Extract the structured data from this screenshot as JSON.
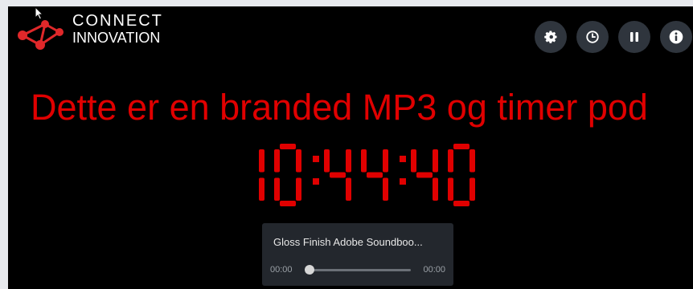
{
  "brand": {
    "line1": "CONNECT",
    "line2": "INNOVATION"
  },
  "controls": [
    {
      "icon": "gear-icon"
    },
    {
      "icon": "clock-icon"
    },
    {
      "icon": "pause-icon"
    },
    {
      "icon": "info-icon"
    }
  ],
  "headline": "Dette er en branded MP3 og timer pod",
  "clock": {
    "time": "10:44:40"
  },
  "player": {
    "track_title": "Gloss Finish Adobe Soundboo...",
    "current_time": "00:00",
    "duration": "00:00",
    "progress": 0
  },
  "colors": {
    "accent": "#e00000",
    "background": "#000000",
    "control_bg": "#2f353d"
  }
}
